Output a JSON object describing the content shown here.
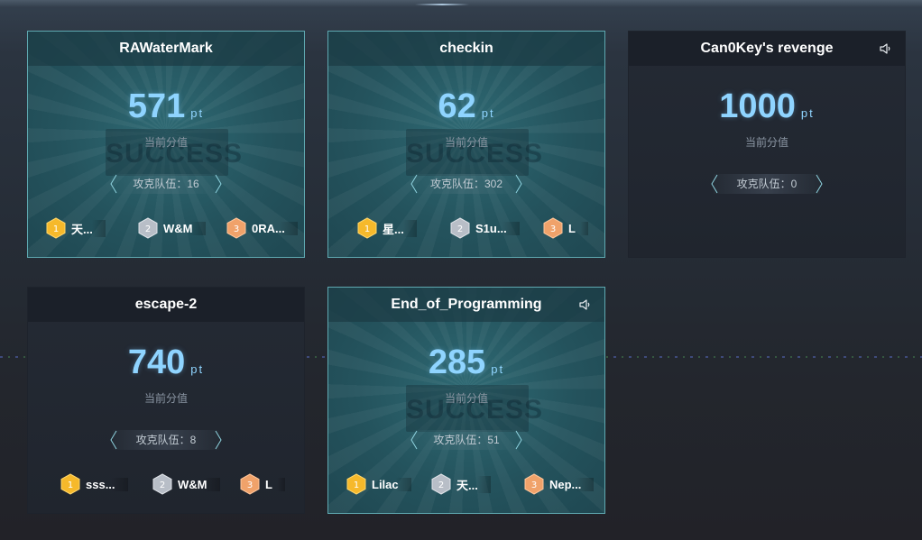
{
  "score_unit": "pt",
  "score_label": "当前分值",
  "solver_prefix": "攻克队伍：",
  "stamp_text": "SUCCESS",
  "colors": {
    "solved_border": "#5fa9b1",
    "score_text": "#8fd4ff",
    "gold": "#f6b92b",
    "silver": "#b8bec7",
    "bronze": "#f0a26a"
  },
  "cards": [
    {
      "title": "RAWaterMark",
      "score": "571",
      "solved": true,
      "sound": false,
      "solvers_text": "攻克队伍：16",
      "ranks": [
        {
          "n": "1",
          "team": "天..."
        },
        {
          "n": "2",
          "team": "W&M"
        },
        {
          "n": "3",
          "team": "0RA..."
        }
      ]
    },
    {
      "title": "checkin",
      "score": "62",
      "solved": true,
      "sound": false,
      "solvers_text": "攻克队伍：302",
      "ranks": [
        {
          "n": "1",
          "team": "星..."
        },
        {
          "n": "2",
          "team": "S1u..."
        },
        {
          "n": "3",
          "team": "L"
        }
      ]
    },
    {
      "title": "Can0Key's revenge",
      "score": "1000",
      "solved": false,
      "sound": true,
      "solvers_text": "攻克队伍：0",
      "ranks": []
    },
    {
      "title": "escape-2",
      "score": "740",
      "solved": false,
      "sound": false,
      "solvers_text": "攻克队伍：8",
      "ranks": [
        {
          "n": "1",
          "team": "sss..."
        },
        {
          "n": "2",
          "team": "W&M"
        },
        {
          "n": "3",
          "team": "L"
        }
      ]
    },
    {
      "title": "End_of_Programming",
      "score": "285",
      "solved": true,
      "sound": true,
      "solvers_text": "攻克队伍：51",
      "ranks": [
        {
          "n": "1",
          "team": "Lilac"
        },
        {
          "n": "2",
          "team": "天..."
        },
        {
          "n": "3",
          "team": "Nep..."
        }
      ]
    }
  ]
}
